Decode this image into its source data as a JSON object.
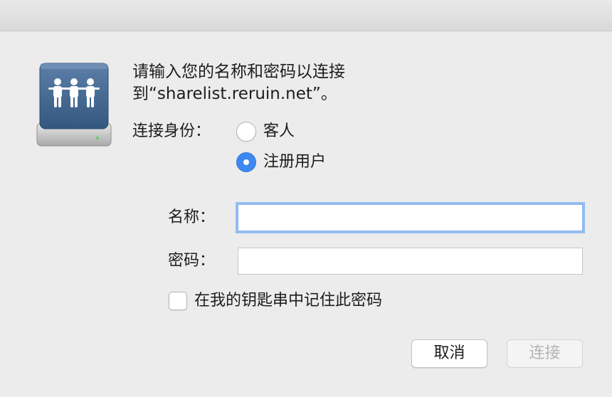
{
  "dialog": {
    "prompt_line1": "请输入您的名称和密码以连接",
    "prompt_line2": "到“sharelist.reruin.net”。",
    "server_icon": "network-server-icon"
  },
  "connect_as": {
    "label": "连接身份：",
    "options": [
      {
        "label": "客人",
        "selected": false
      },
      {
        "label": "注册用户",
        "selected": true
      }
    ]
  },
  "fields": {
    "name": {
      "label": "名称：",
      "value": ""
    },
    "password": {
      "label": "密码：",
      "value": ""
    }
  },
  "keychain": {
    "label": "在我的钥匙串中记住此密码",
    "checked": false
  },
  "buttons": {
    "cancel": "取消",
    "connect": "连接"
  },
  "colors": {
    "accent": "#3d88f0",
    "focus_ring": "#93bdf2",
    "window_bg": "#ececec",
    "disabled_text": "#b4b4b4"
  }
}
